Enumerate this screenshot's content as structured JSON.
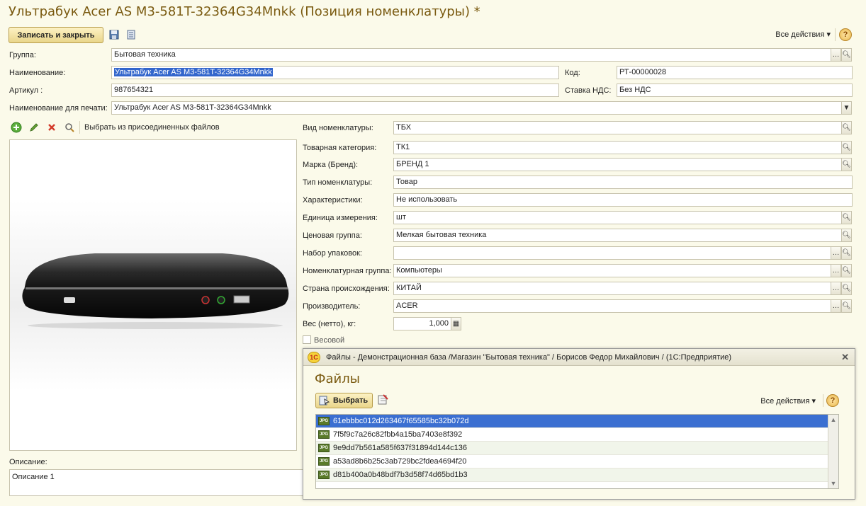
{
  "window": {
    "title": "Ультрабук Acer AS M3-581T-32364G34Mnkk (Позиция номенклатуры) *"
  },
  "toolbar": {
    "save_close_label": "Записать и закрыть",
    "all_actions_label": "Все действия ▾",
    "help_label": "?"
  },
  "fields": {
    "group_label": "Группа:",
    "group_value": "Бытовая техника",
    "name_label": "Наименование:",
    "name_value": "Ультрабук Acer AS M3-581T-32364G34Mnkk",
    "code_label": "Код:",
    "code_value": "РТ-00000028",
    "article_label": "Артикул :",
    "article_value": "987654321",
    "vat_label": "Ставка НДС:",
    "vat_value": "Без НДС",
    "print_name_label": "Наименование для печати:",
    "print_name_value": "Ультрабук Acer AS M3-581T-32364G34Mnkk"
  },
  "image_toolbar": {
    "select_attached_label": "Выбрать из присоединенных файлов"
  },
  "props": [
    {
      "label": "Вид номенклатуры:",
      "value": "ТБХ"
    },
    {
      "label": "Товарная категория:",
      "value": "ТК1"
    },
    {
      "label": "Марка (Бренд):",
      "value": "БРЕНД 1"
    },
    {
      "label": "Тип номенклатуры:",
      "value": "Товар"
    },
    {
      "label": "Характеристики:",
      "value": "Не использовать"
    },
    {
      "label": "Единица измерения:",
      "value": "шт"
    },
    {
      "label": "Ценовая группа:",
      "value": "Мелкая бытовая техника"
    },
    {
      "label": "Набор упаковок:",
      "value": ""
    },
    {
      "label": "Номенклатурная группа:",
      "value": "Компьютеры"
    },
    {
      "label": "Страна происхождения:",
      "value": "КИТАЙ"
    },
    {
      "label": "Производитель:",
      "value": "ACER"
    },
    {
      "label": "Вес (нетто), кг:",
      "value": "1,000"
    }
  ],
  "weighted_label": "Весовой",
  "description": {
    "label": "Описание:",
    "value": "Описание 1"
  },
  "files_dialog": {
    "window_title": "Файлы - Демонстрационная база /Магазин \"Бытовая техника\" / Борисов Федор Михайлович /  (1С:Предприятие)",
    "logo_text": "1C",
    "heading": "Файлы",
    "select_label": "Выбрать",
    "all_actions_label": "Все действия ▾",
    "help_label": "?",
    "close_label": "✕",
    "file_icon_text": "JPG",
    "files": [
      "61ebbbc012d263467f65585bc32b072d",
      "7f5f9c7a26c82fbb4a15ba7403e8f392",
      "9e9dd7b561a585f637f31894d144c136",
      "a53ad8b6b25c3ab729bc2fdea4694f20",
      "d81b400a0b48bdf7b3d58f74d65bd1b3"
    ]
  }
}
